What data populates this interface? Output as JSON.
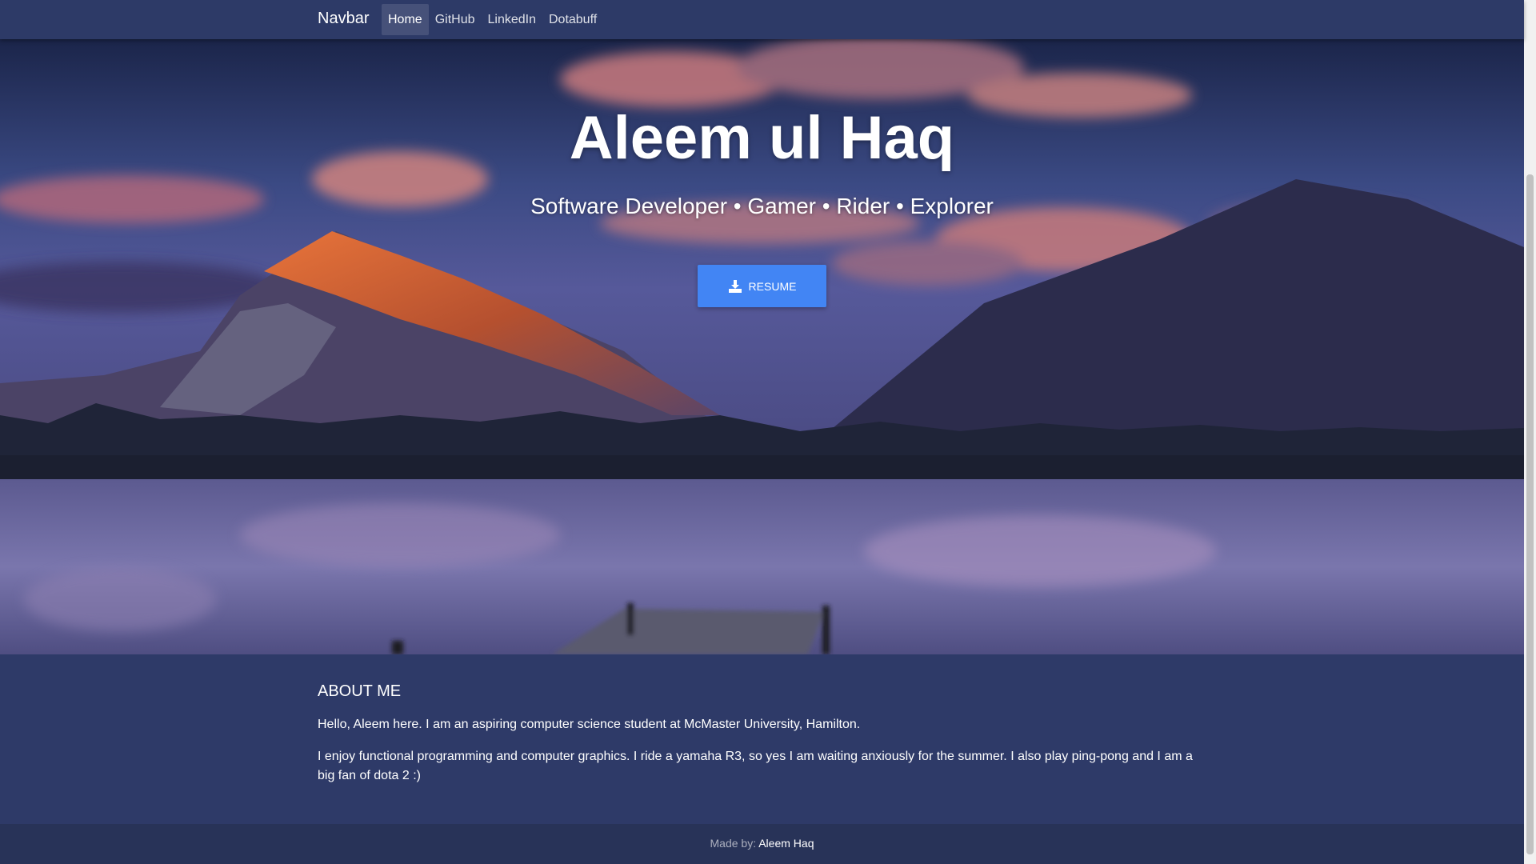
{
  "navbar": {
    "brand": "Navbar",
    "links": [
      {
        "label": "Home"
      },
      {
        "label": "GitHub"
      },
      {
        "label": "LinkedIn"
      },
      {
        "label": "Dotabuff"
      }
    ]
  },
  "hero": {
    "title": "Aleem ul Haq",
    "subtitle": "Software Developer • Gamer • Rider • Explorer",
    "resume_label": "RESUME",
    "resume_icon": "download-icon",
    "button_color": "#4285f4"
  },
  "about": {
    "heading": "ABOUT ME",
    "paragraphs": [
      "Hello, Aleem here. I am an aspiring computer science student at McMaster University, Hamilton.",
      "I enjoy functional programming and computer graphics. I ride a yamaha R3, so yes I am waiting anxiously for the summer. I also play ping-pong and I am a big fan of dota 2 :)"
    ]
  },
  "footer": {
    "label": "Made by: ",
    "author": "Aleem Haq"
  },
  "colors": {
    "navbar": "#2d3a67",
    "background": "#2e3a68",
    "footer": "#283358"
  }
}
